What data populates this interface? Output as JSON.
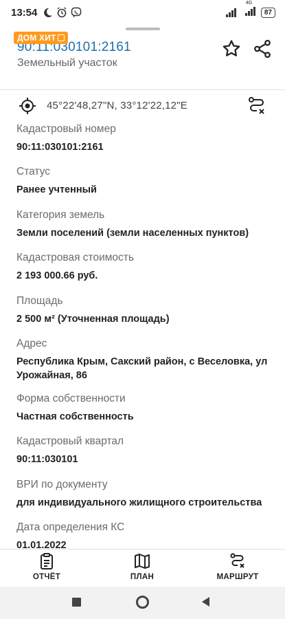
{
  "status_bar": {
    "time": "13:54",
    "network": "4G",
    "battery": "87"
  },
  "header": {
    "badge": "ДОМ ХИТ",
    "cadastral_number": "90:11:030101:2161",
    "object_type": "Земельный участок"
  },
  "location": {
    "coordinates": "45°22'48,27\"N, 33°12'22,12\"E"
  },
  "fields": [
    {
      "label": "Кадастровый номер",
      "value": "90:11:030101:2161"
    },
    {
      "label": "Статус",
      "value": "Ранее учтенный"
    },
    {
      "label": "Категория земель",
      "value": "Земли поселений (земли населенных пунктов)"
    },
    {
      "label": "Кадастровая стоимость",
      "value": "2 193 000.66 руб."
    },
    {
      "label": "Площадь",
      "value": "2 500 м² (Уточненная площадь)"
    },
    {
      "label": "Адрес",
      "value": "Республика Крым, Сакский район, с Веселовка, ул Урожайная, 86"
    },
    {
      "label": "Форма собственности",
      "value": "Частная собственность"
    },
    {
      "label": "Кадастровый квартал",
      "value": "90:11:030101"
    },
    {
      "label": "ВРИ по документу",
      "value": "для индивидуального жилищного строительства"
    },
    {
      "label": "Дата определения КС",
      "value": "01.01.2022"
    }
  ],
  "bottom_nav": {
    "report": "ОТЧЁТ",
    "plan": "ПЛАН",
    "route": "МАРШРУТ"
  },
  "colors": {
    "accent": "#1e6fa8",
    "badge": "#ff9a1f"
  }
}
